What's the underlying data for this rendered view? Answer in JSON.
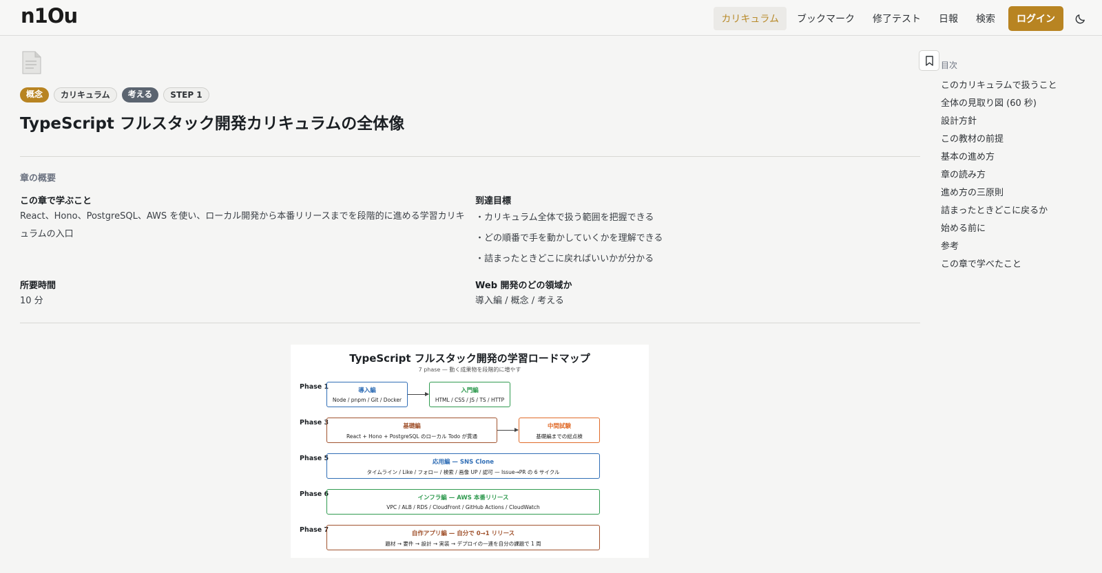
{
  "header": {
    "logo": "n1Ou",
    "nav": [
      "カリキュラム",
      "ブックマーク",
      "修了テスト",
      "日報",
      "検索"
    ],
    "login": "ログイン"
  },
  "tags": [
    "概念",
    "カリキュラム",
    "考える",
    "STEP 1"
  ],
  "title": "TypeScript フルスタック開発カリキュラムの全体像",
  "overview": {
    "label": "章の概要",
    "learn_heading": "この章で学ぶこと",
    "learn_text": "React、Hono、PostgreSQL、AWS を使い、ローカル開発から本番リリースまでを段階的に進める学習カリキュラムの入口",
    "goal_heading": "到達目標",
    "goals": [
      "・カリキュラム全体で扱う範囲を把握できる",
      "・どの順番で手を動かしていくかを理解できる",
      "・詰まったときどこに戻ればいいかが分かる"
    ],
    "time_heading": "所要時間",
    "time_value": "10 分",
    "area_heading": "Web 開発のどの領域か",
    "area_value": "導入編 / 概念 / 考える"
  },
  "roadmap": {
    "title": "TypeScript フルスタック開発の学習ロードマップ",
    "subtitle": "7 phase — 動く成果物を段階的に増やす",
    "phases": [
      "Phase 1",
      "Phase 3",
      "Phase 5",
      "Phase 6",
      "Phase 7"
    ],
    "boxes": [
      {
        "title": "導入編",
        "sub": "Node / pnpm / Git / Docker"
      },
      {
        "title": "入門編",
        "sub": "HTML / CSS / JS / TS / HTTP"
      },
      {
        "title": "基礎編",
        "sub": "React + Hono + PostgreSQL のローカル Todo が貫通"
      },
      {
        "title": "中間試験",
        "sub": "基礎編までの総点検"
      },
      {
        "title": "応用編 — SNS Clone",
        "sub": "タイムライン / Like / フォロー / 検索 / 画像 UP / 認可 — Issue→PR の 6 サイクル"
      },
      {
        "title": "インフラ編 — AWS 本番リリース",
        "sub": "VPC / ALB / RDS / CloudFront / GitHub Actions / CloudWatch"
      },
      {
        "title": "自作アプリ編 — 自分で 0→1 リリース",
        "sub": "題材 → 要件 → 設計 → 実装 → デプロイの一連を自分の課題で 1 周"
      }
    ]
  },
  "toc": {
    "title": "目次",
    "items": [
      "このカリキュラムで扱うこと",
      "全体の見取り図 (60 秒)",
      "設計方針",
      "この教材の前提",
      "基本の進め方",
      "章の読み方",
      "進め方の三原則",
      "詰まったときどこに戻るか",
      "始める前に",
      "参考",
      "この章で学べたこと"
    ]
  },
  "colors": {
    "accent": "#b88422",
    "blue": "#2f6db5",
    "green": "#2f9a4f",
    "brown": "#a0522d",
    "orange": "#e06a28"
  }
}
